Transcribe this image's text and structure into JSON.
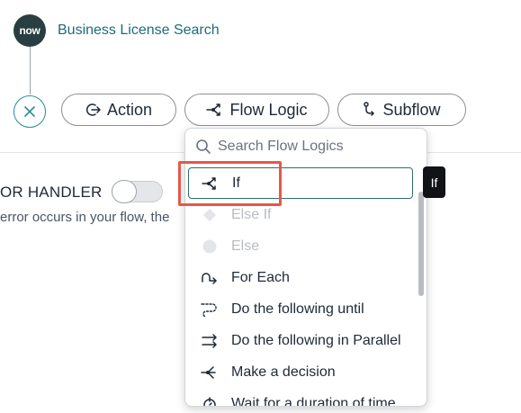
{
  "app": {
    "logo_text": "now"
  },
  "trigger": {
    "title": "Business License Search"
  },
  "toolbar": {
    "action_label": "Action",
    "flow_logic_label": "Flow Logic",
    "subflow_label": "Subflow"
  },
  "error_handler": {
    "label": "OR HANDLER",
    "description": "error occurs in your flow, the",
    "toggle_on": false
  },
  "dropdown": {
    "search_placeholder": "Search Flow Logics",
    "items": [
      {
        "label": "If",
        "icon": "branch-icon",
        "state": "selected"
      },
      {
        "label": "Else If",
        "icon": "diamond-icon",
        "state": "disabled"
      },
      {
        "label": "Else",
        "icon": "circle-icon",
        "state": "disabled"
      },
      {
        "label": "For Each",
        "icon": "loop-arrow-icon",
        "state": "enabled"
      },
      {
        "label": "Do the following until",
        "icon": "dashed-loop-icon",
        "state": "enabled"
      },
      {
        "label": "Do the following in Parallel",
        "icon": "parallel-arrows-icon",
        "state": "enabled"
      },
      {
        "label": "Make a decision",
        "icon": "decision-branch-icon",
        "state": "enabled"
      },
      {
        "label": "Wait for a duration of time",
        "icon": "timer-icon",
        "state": "enabled"
      }
    ]
  },
  "tooltip": {
    "text": "If"
  },
  "colors": {
    "accent": "#2a8c8c",
    "highlight": "#e5584a",
    "link": "#1e6b7a"
  }
}
